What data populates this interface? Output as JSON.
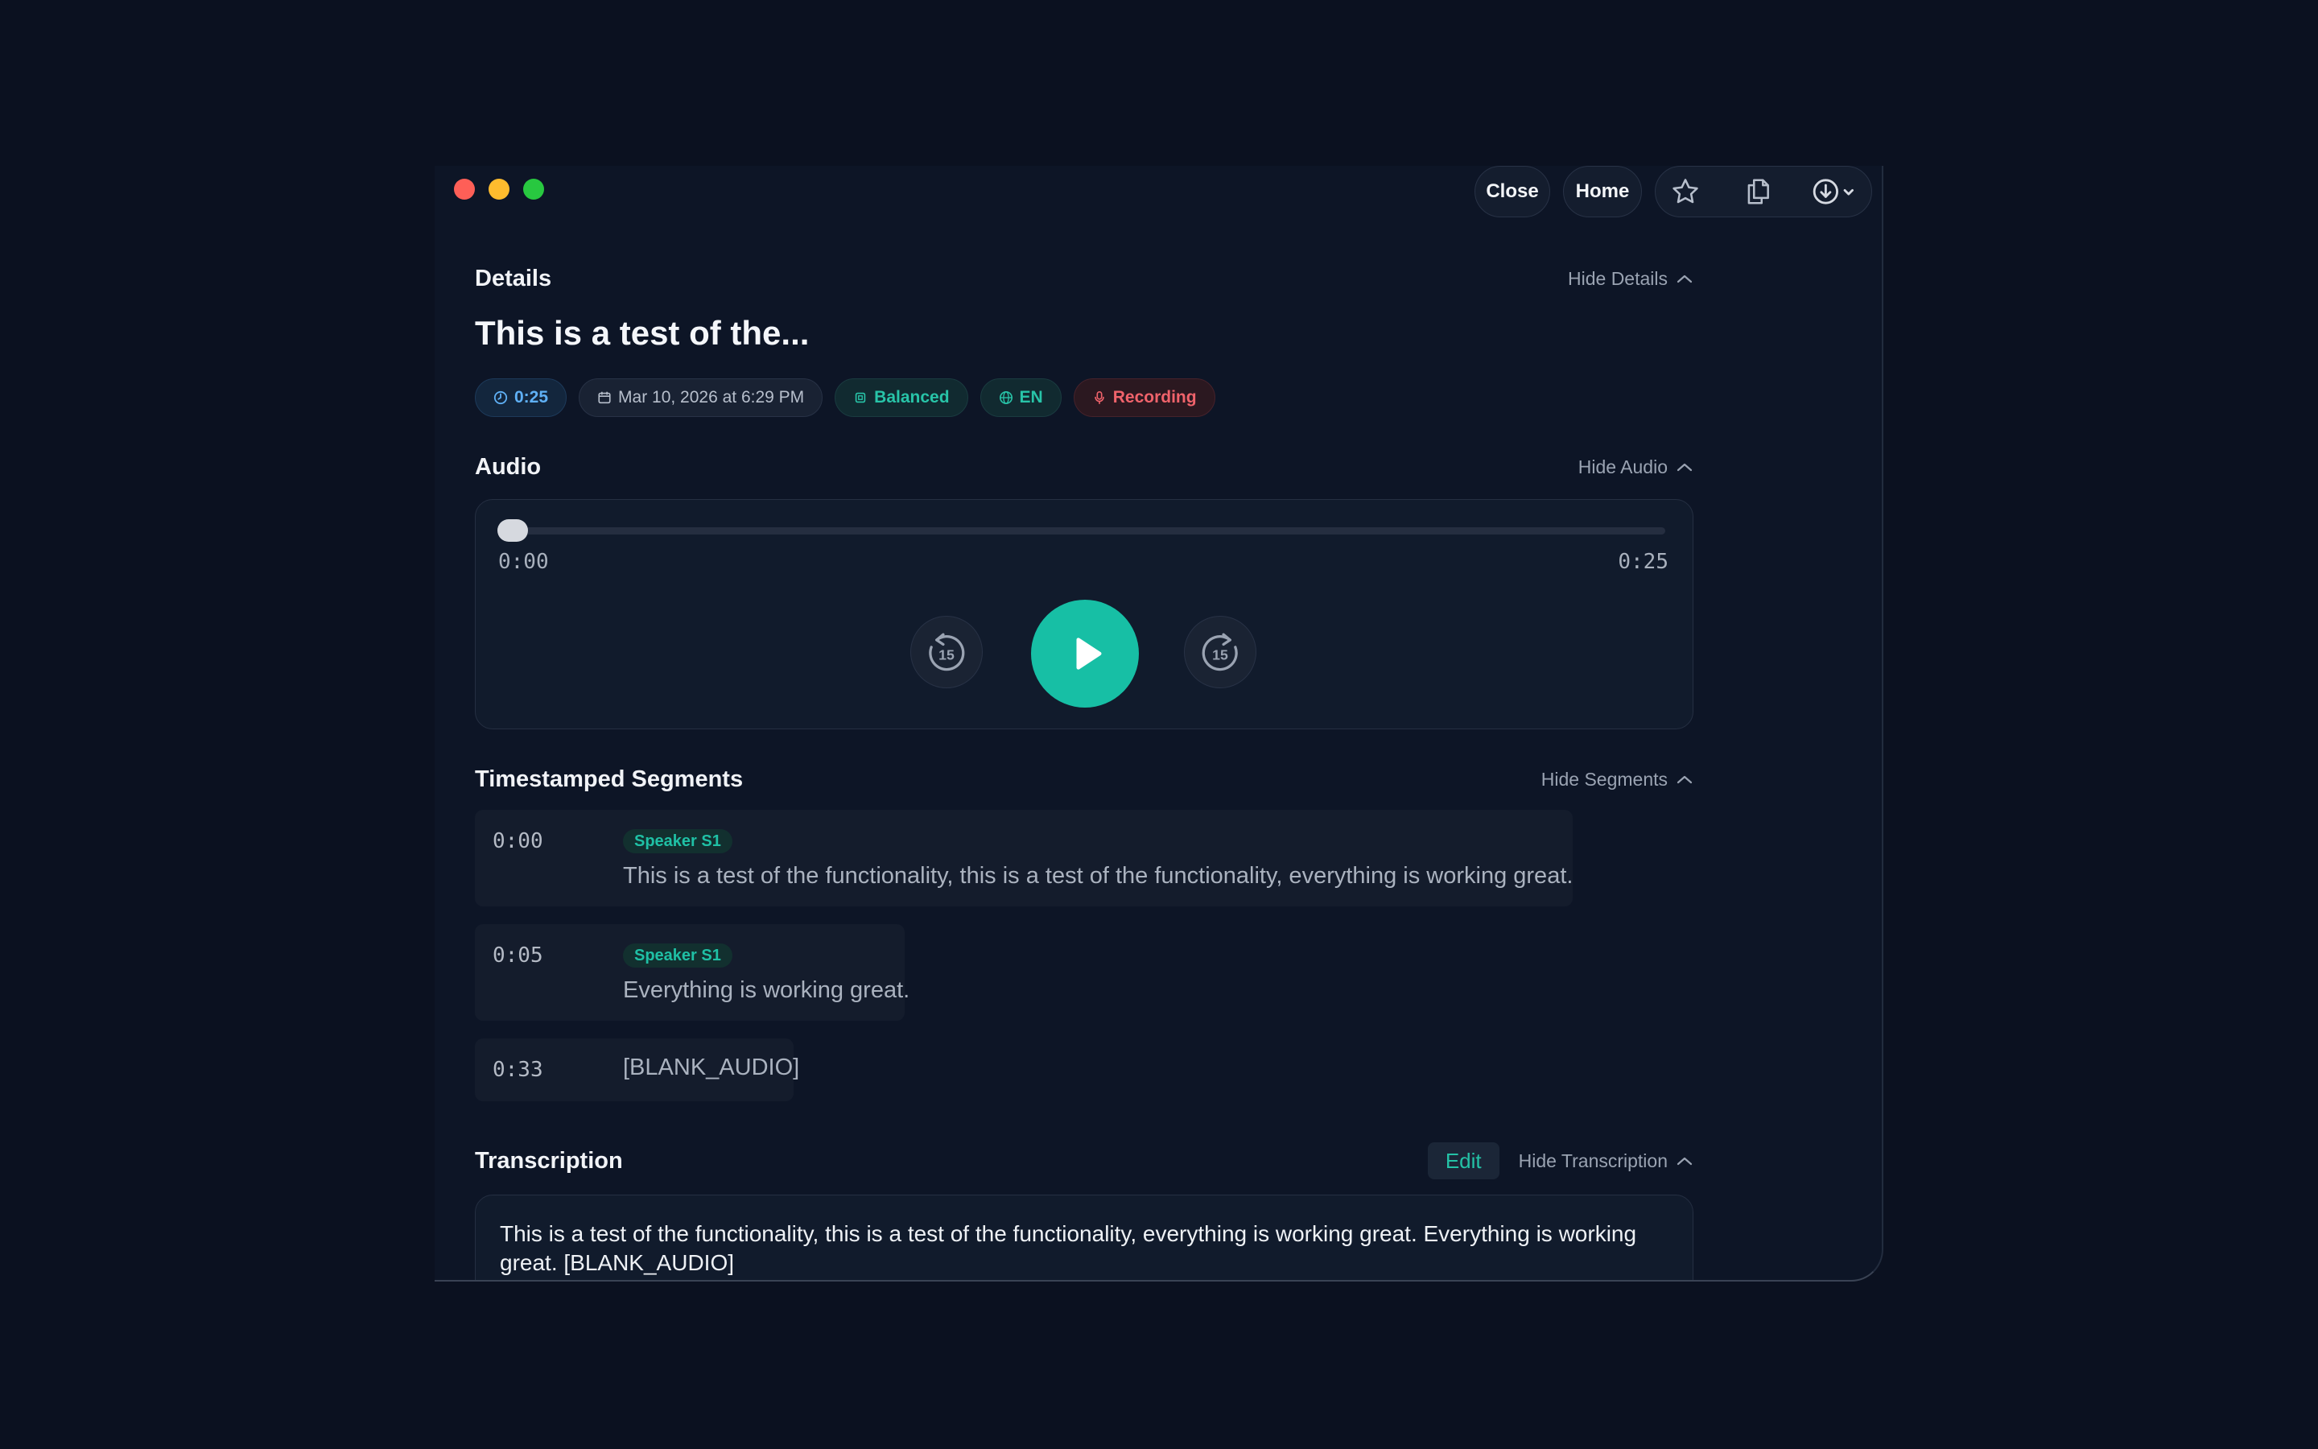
{
  "toolbar": {
    "close_label": "Close",
    "home_label": "Home",
    "icons": [
      "star-icon",
      "copy-icon",
      "download-icon",
      "chevron-down-icon"
    ]
  },
  "details": {
    "heading": "Details",
    "hide_label": "Hide Details",
    "title": "This is a test of the...",
    "chips": {
      "duration": "0:25",
      "date": "Mar 10, 2026 at 6:29 PM",
      "quality": "Balanced",
      "language": "EN",
      "source": "Recording"
    }
  },
  "audio": {
    "heading": "Audio",
    "hide_label": "Hide Audio",
    "current_time": "0:00",
    "total_time": "0:25",
    "progress": 0,
    "skip_seconds": "15"
  },
  "segments": {
    "heading": "Timestamped Segments",
    "hide_label": "Hide Segments",
    "items": [
      {
        "time": "0:00",
        "speaker": "Speaker S1",
        "text": "This is a test of the functionality, this is a test of the functionality, everything is working great."
      },
      {
        "time": "0:05",
        "speaker": "Speaker S1",
        "text": "Everything is working great."
      },
      {
        "time": "0:33",
        "speaker": "",
        "text": "[BLANK_AUDIO]"
      }
    ]
  },
  "transcription": {
    "heading": "Transcription",
    "edit_label": "Edit",
    "hide_label": "Hide Transcription",
    "text": "This is a test of the functionality, this is a test of the functionality, everything is working great. Everything is working great. [BLANK_AUDIO]"
  },
  "colors": {
    "accent": "#17bfa5",
    "background": "#0b1120",
    "recording": "#f0636b",
    "duration": "#5fb0f5"
  }
}
